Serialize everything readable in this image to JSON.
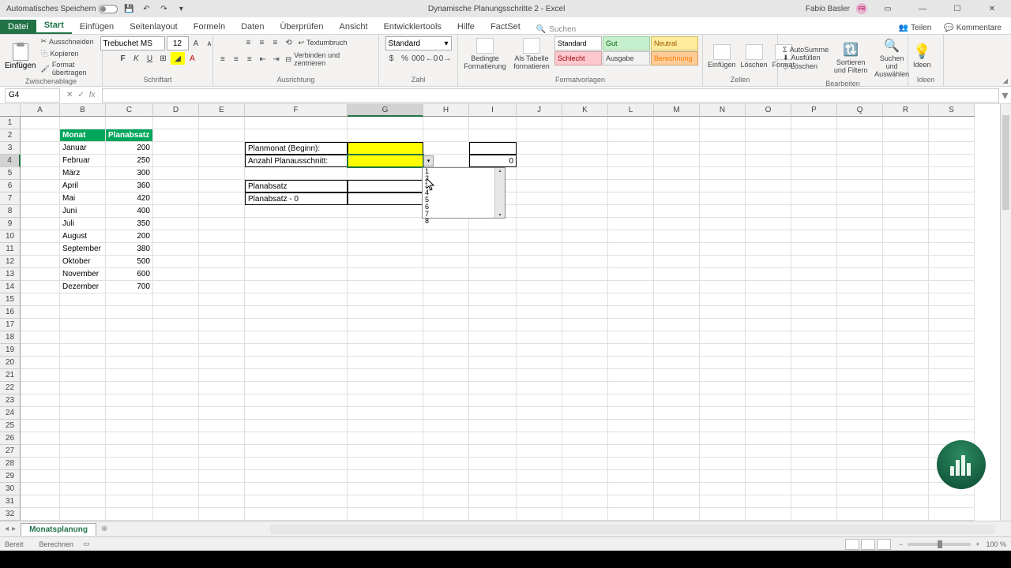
{
  "titlebar": {
    "autosave": "Automatisches Speichern",
    "doc_title": "Dynamische Planungsschritte 2  -  Excel",
    "user_name": "Fabio Basler",
    "user_initials": "FB"
  },
  "tabs": {
    "file": "Datei",
    "start": "Start",
    "insert": "Einfügen",
    "layout": "Seitenlayout",
    "formulas": "Formeln",
    "data": "Daten",
    "review": "Überprüfen",
    "view": "Ansicht",
    "developer": "Entwicklertools",
    "help": "Hilfe",
    "factset": "FactSet",
    "search": "Suchen",
    "share": "Teilen",
    "comments": "Kommentare"
  },
  "ribbon": {
    "paste": "Einfügen",
    "cut": "Ausschneiden",
    "copy": "Kopieren",
    "format_painter": "Format übertragen",
    "clipboard": "Zwischenablage",
    "font_name": "Trebuchet MS",
    "font_size": "12",
    "font_group": "Schriftart",
    "wrap": "Textumbruch",
    "merge": "Verbinden und zentrieren",
    "align_group": "Ausrichtung",
    "number_fmt": "Standard",
    "number_group": "Zahl",
    "cond_fmt": "Bedingte Formatierung",
    "as_table": "Als Tabelle formatieren",
    "sw_standard": "Standard",
    "sw_gut": "Gut",
    "sw_neutral": "Neutral",
    "sw_schlecht": "Schlecht",
    "sw_ausgabe": "Ausgabe",
    "sw_berech": "Berechnung",
    "styles_group": "Formatvorlagen",
    "insert_cells": "Einfügen",
    "delete_cells": "Löschen",
    "format_cells": "Format",
    "cells_group": "Zellen",
    "autosum": "AutoSumme",
    "fill": "Ausfüllen",
    "clear": "Löschen",
    "sort": "Sortieren und Filtern",
    "find": "Suchen und Auswählen",
    "editing_group": "Bearbeiten",
    "ideas": "Ideen"
  },
  "formula_bar": {
    "name_box": "G4"
  },
  "columns": [
    {
      "l": "A",
      "w": 50
    },
    {
      "l": "B",
      "w": 58
    },
    {
      "l": "C",
      "w": 60
    },
    {
      "l": "D",
      "w": 58
    },
    {
      "l": "E",
      "w": 58
    },
    {
      "l": "F",
      "w": 130
    },
    {
      "l": "G",
      "w": 96
    },
    {
      "l": "H",
      "w": 58
    },
    {
      "l": "I",
      "w": 60
    },
    {
      "l": "J",
      "w": 58
    },
    {
      "l": "K",
      "w": 58
    },
    {
      "l": "L",
      "w": 58
    },
    {
      "l": "M",
      "w": 58
    },
    {
      "l": "N",
      "w": 58
    },
    {
      "l": "O",
      "w": 58
    },
    {
      "l": "P",
      "w": 58
    },
    {
      "l": "Q",
      "w": 58
    },
    {
      "l": "R",
      "w": 58
    },
    {
      "l": "S",
      "w": 58
    }
  ],
  "row_count": 32,
  "headers": {
    "monat": "Monat",
    "planabsatz": "Planabsatz"
  },
  "months": [
    {
      "m": "Januar",
      "v": "200"
    },
    {
      "m": "Februar",
      "v": "250"
    },
    {
      "m": "März",
      "v": "300"
    },
    {
      "m": "April",
      "v": "360"
    },
    {
      "m": "Mai",
      "v": "420"
    },
    {
      "m": "Juni",
      "v": "400"
    },
    {
      "m": "Juli",
      "v": "350"
    },
    {
      "m": "August",
      "v": "200"
    },
    {
      "m": "September",
      "v": "380"
    },
    {
      "m": "Oktober",
      "v": "500"
    },
    {
      "m": "November",
      "v": "600"
    },
    {
      "m": "Dezember",
      "v": "700"
    }
  ],
  "labels": {
    "planmonat": "Planmonat (Beginn):",
    "anzahl": "Anzahl Planausschnitt:",
    "planabsatz": "Planabsatz",
    "planabsatz_minus": "Planabsatz  - 0"
  },
  "i4_value": "0",
  "dd_options": [
    "1",
    "2",
    "3",
    "4",
    "5",
    "6",
    "7",
    "8"
  ],
  "sheet": {
    "name": "Monatsplanung"
  },
  "status": {
    "ready": "Bereit",
    "calc": "Berechnen",
    "zoom": "100 %"
  }
}
